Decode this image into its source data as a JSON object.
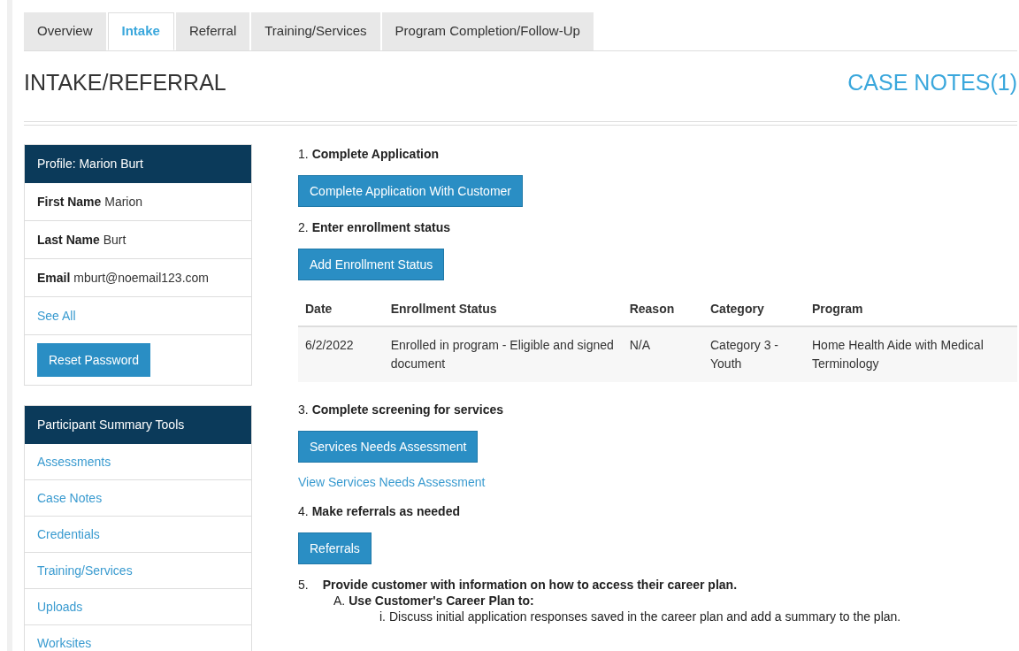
{
  "tabs": [
    {
      "label": "Overview",
      "selected": false
    },
    {
      "label": "Intake",
      "selected": true
    },
    {
      "label": "Referral",
      "selected": false
    },
    {
      "label": "Training/Services",
      "selected": false
    },
    {
      "label": "Program Completion/Follow-Up",
      "selected": false
    }
  ],
  "page_title": "INTAKE/REFERRAL",
  "case_notes_link": "CASE NOTES(1)",
  "profile": {
    "title": "Profile: Marion Burt",
    "fields": [
      {
        "label": "First Name",
        "value": "Marion"
      },
      {
        "label": "Last Name",
        "value": "Burt"
      },
      {
        "label": "Email",
        "value": "mburt@noemail123.com"
      }
    ],
    "see_all": "See All",
    "reset_button": "Reset Password"
  },
  "tools": {
    "title": "Participant Summary Tools",
    "items": [
      "Assessments",
      "Case Notes",
      "Credentials",
      "Training/Services",
      "Uploads",
      "Worksites"
    ]
  },
  "steps": [
    {
      "number": "1.",
      "title": "Complete Application",
      "content": [
        {
          "kind": "button",
          "label": "Complete Application With Customer"
        }
      ]
    },
    {
      "number": "2.",
      "title": "Enter enrollment status",
      "content": [
        {
          "kind": "button",
          "label": "Add Enrollment Status"
        },
        {
          "kind": "table",
          "columns": [
            "Date",
            "Enrollment Status",
            "Reason",
            "Category",
            "Program"
          ],
          "rows": [
            [
              "6/2/2022",
              "Enrolled in program - Eligible and signed document",
              "N/A",
              "Category 3 - Youth",
              "Home Health Aide with Medical Terminology"
            ]
          ]
        }
      ]
    },
    {
      "number": "3.",
      "title": "Complete screening for services",
      "content": [
        {
          "kind": "button",
          "label": "Services Needs Assessment"
        },
        {
          "kind": "link",
          "label": "View Services Needs Assessment"
        }
      ]
    },
    {
      "number": "4.",
      "title": "Make referrals as needed",
      "content": [
        {
          "kind": "button",
          "label": "Referrals"
        }
      ]
    },
    {
      "number": "5.",
      "title": "Provide customer with information on how to access their career plan.",
      "content": [
        {
          "kind": "outline",
          "marker": "A.",
          "title": "Use Customer's Career Plan to:",
          "children": [
            {
              "marker": "i.",
              "text": "Discuss initial application responses saved in the career plan and add a summary to the plan."
            }
          ]
        }
      ]
    }
  ]
}
